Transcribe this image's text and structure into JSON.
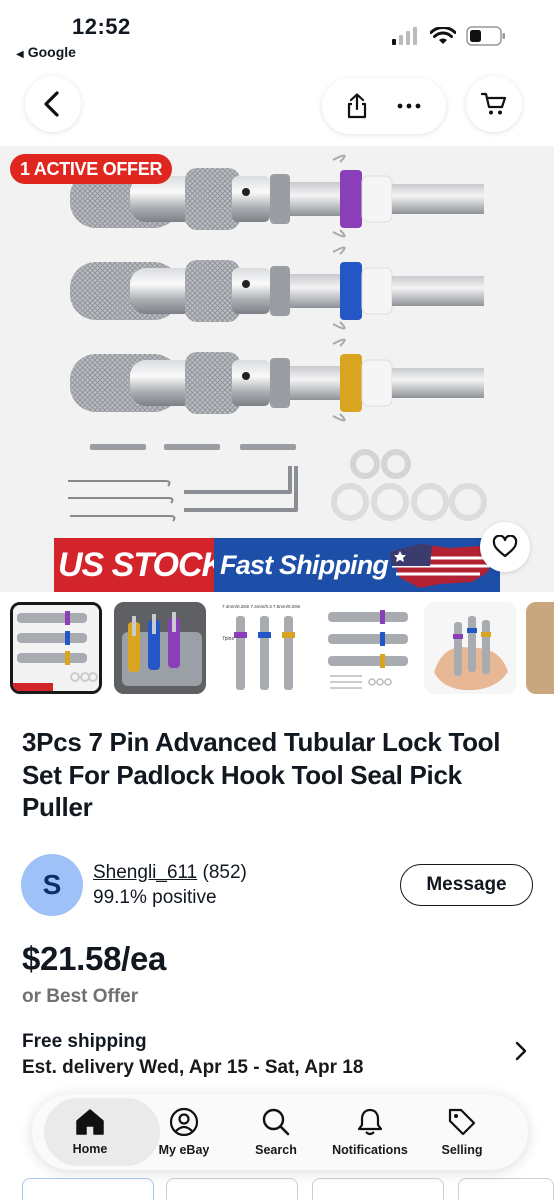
{
  "status_bar": {
    "time": "12:52",
    "back_app": "Google"
  },
  "hero": {
    "offer_badge": "1 ACTIVE OFFER",
    "banner_left": "US STOCK",
    "banner_right": "Fast Shipping"
  },
  "thumbnail_labels": {
    "t3_head": "7.4mm/0.28in  7.4mm/0.3  7.5mm/0.29in",
    "t3_side": "7pins"
  },
  "listing": {
    "title": "3Pcs 7 Pin Advanced Tubular Lock Tool Set For Padlock Hook Tool Seal Pick Puller"
  },
  "seller": {
    "initial": "S",
    "name": "Shengli_611",
    "count": "(852)",
    "feedback": "99.1% positive",
    "message_label": "Message"
  },
  "price": {
    "amount": "$21.58/ea",
    "best_offer": "or Best Offer"
  },
  "shipping": {
    "title": "Free shipping",
    "estimate": "Est. delivery Wed, Apr 15 - Sat, Apr 18"
  },
  "tabbar": {
    "items": [
      {
        "label": "Home",
        "icon": "home-icon"
      },
      {
        "label": "My eBay",
        "icon": "user-icon"
      },
      {
        "label": "Search",
        "icon": "search-icon"
      },
      {
        "label": "Notifications",
        "icon": "bell-icon"
      },
      {
        "label": "Selling",
        "icon": "tag-icon"
      }
    ]
  },
  "colors": {
    "offer_red": "#e0271f",
    "banner_red": "#d3232b",
    "banner_blue": "#1d4fa8",
    "avatar_blue": "#9ec2f8",
    "ring_purple": "#8a3fb8",
    "ring_blue": "#2456c6",
    "ring_gold": "#d9a520"
  }
}
